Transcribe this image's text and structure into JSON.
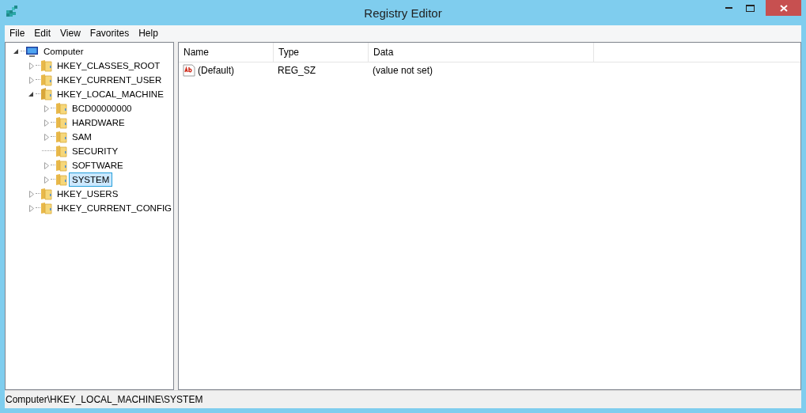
{
  "window": {
    "title": "Registry Editor"
  },
  "menu": [
    "File",
    "Edit",
    "View",
    "Favorites",
    "Help"
  ],
  "tree": [
    {
      "label": "Computer",
      "kind": "computer",
      "expandable": true,
      "expanded": true,
      "selected": false,
      "children": [
        {
          "label": "HKEY_CLASSES_ROOT",
          "kind": "folder",
          "expandable": true,
          "expanded": false,
          "selected": false
        },
        {
          "label": "HKEY_CURRENT_USER",
          "kind": "folder",
          "expandable": true,
          "expanded": false,
          "selected": false
        },
        {
          "label": "HKEY_LOCAL_MACHINE",
          "kind": "folder",
          "expandable": true,
          "expanded": true,
          "selected": false,
          "children": [
            {
              "label": "BCD00000000",
              "kind": "folder",
              "expandable": true,
              "expanded": false,
              "selected": false
            },
            {
              "label": "HARDWARE",
              "kind": "folder",
              "expandable": true,
              "expanded": false,
              "selected": false
            },
            {
              "label": "SAM",
              "kind": "folder",
              "expandable": true,
              "expanded": false,
              "selected": false
            },
            {
              "label": "SECURITY",
              "kind": "folder",
              "expandable": false,
              "expanded": false,
              "selected": false
            },
            {
              "label": "SOFTWARE",
              "kind": "folder",
              "expandable": true,
              "expanded": false,
              "selected": false
            },
            {
              "label": "SYSTEM",
              "kind": "folder",
              "expandable": true,
              "expanded": false,
              "selected": true
            }
          ]
        },
        {
          "label": "HKEY_USERS",
          "kind": "folder",
          "expandable": true,
          "expanded": false,
          "selected": false
        },
        {
          "label": "HKEY_CURRENT_CONFIG",
          "kind": "folder",
          "expandable": true,
          "expanded": false,
          "selected": false
        }
      ]
    }
  ],
  "list": {
    "columns": [
      "Name",
      "Type",
      "Data"
    ],
    "rows": [
      {
        "name": "(Default)",
        "type": "REG_SZ",
        "data": "(value not set)"
      }
    ]
  },
  "status_bar": "Computer\\HKEY_LOCAL_MACHINE\\SYSTEM"
}
